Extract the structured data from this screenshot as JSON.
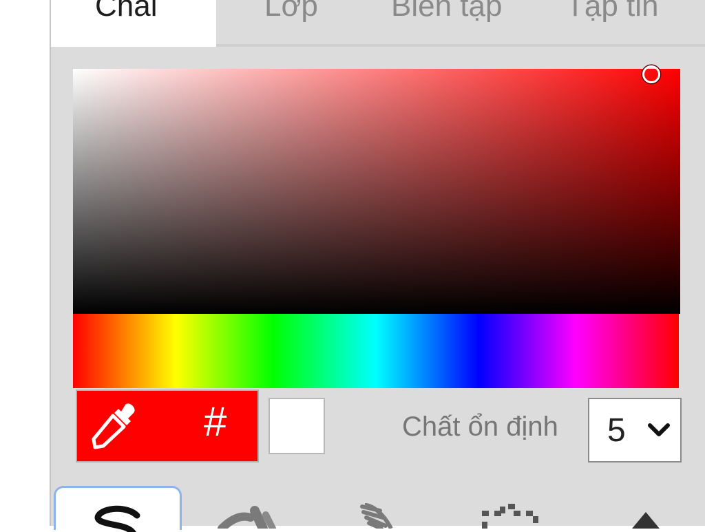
{
  "tabs": [
    {
      "label": "Chải",
      "active": true
    },
    {
      "label": "Lớp",
      "active": false
    },
    {
      "label": "Biên tập",
      "active": false
    },
    {
      "label": "Tập tin",
      "active": false
    }
  ],
  "color_picker": {
    "current_color": "#ff0000",
    "hue": "#ff0000",
    "hex_button_label": "#",
    "secondary_color": "#ffffff"
  },
  "stabilizer": {
    "label": "Chất ổn định",
    "value": "5"
  },
  "tools": [
    {
      "name": "pen-tool",
      "active": true
    },
    {
      "name": "brush-tool",
      "active": false
    },
    {
      "name": "blend-tool",
      "active": false
    },
    {
      "name": "select-tool",
      "active": false
    },
    {
      "name": "fill-tool",
      "active": false
    }
  ]
}
